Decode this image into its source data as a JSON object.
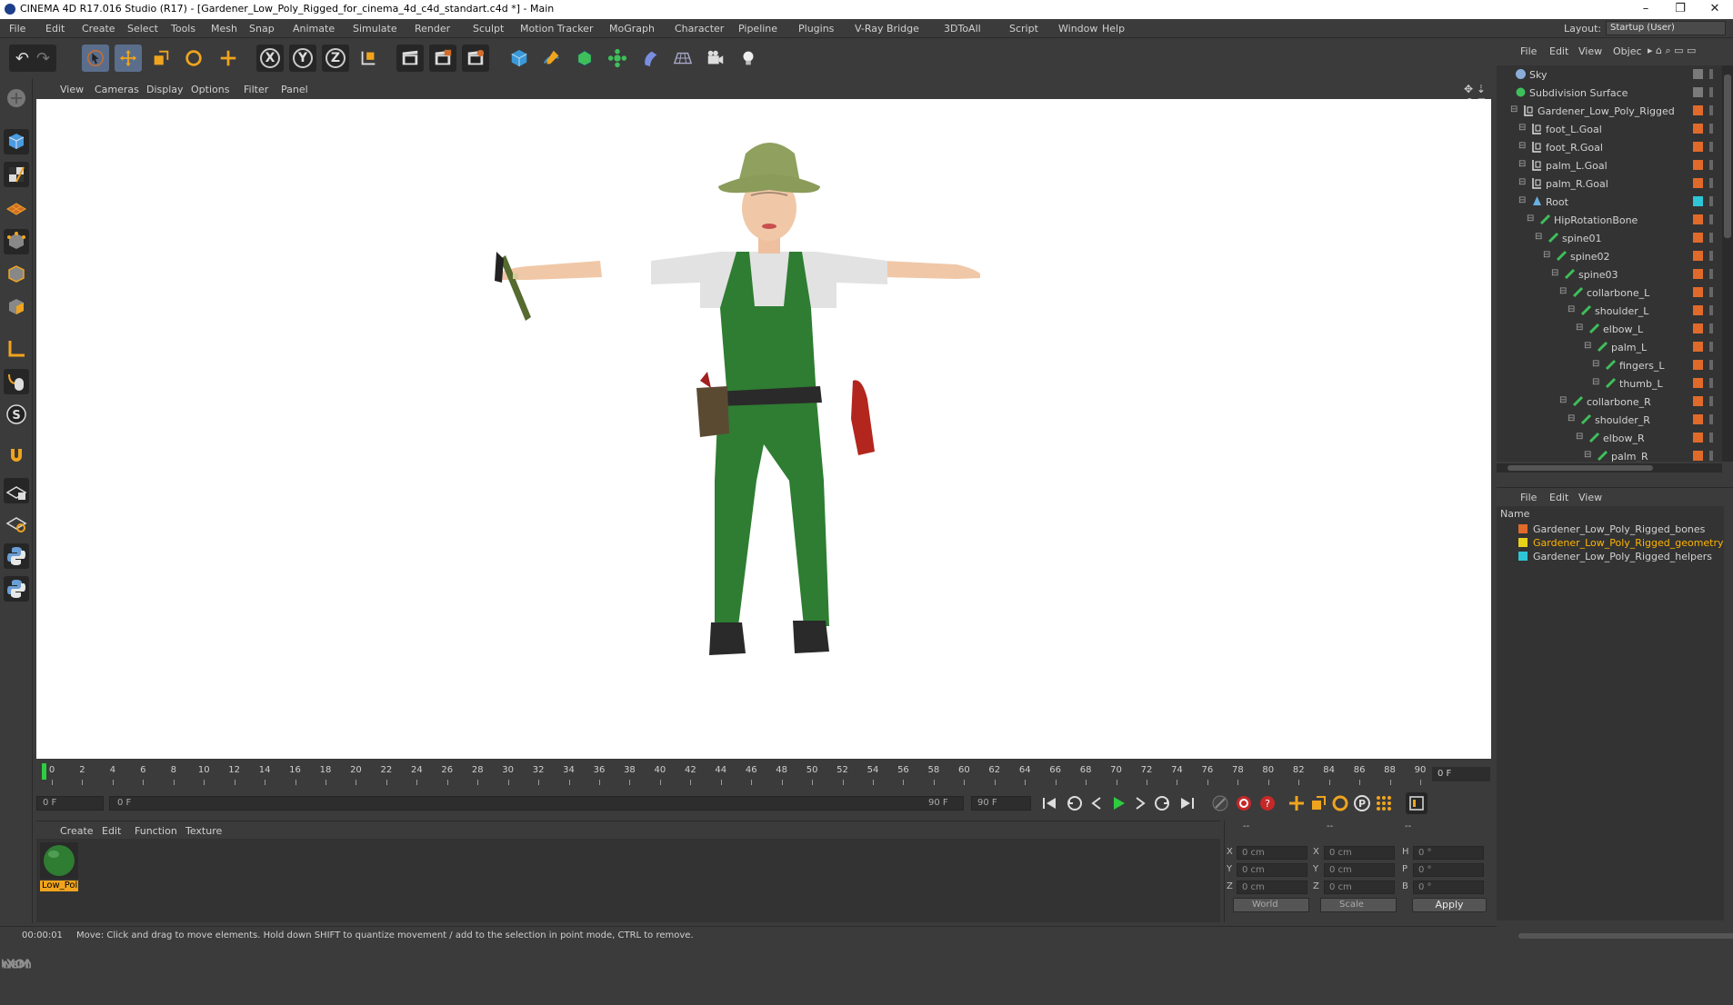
{
  "window": {
    "title": "CINEMA 4D R17.016 Studio (R17) - [Gardener_Low_Poly_Rigged_for_cinema_4d_c4d_standart.c4d *] - Main",
    "minimize": "–",
    "restore": "❐",
    "close": "✕"
  },
  "menubar": {
    "items": [
      "File",
      "Edit",
      "Create",
      "Select",
      "Tools",
      "Mesh",
      "Snap",
      "Animate",
      "Simulate",
      "Render",
      "Sculpt",
      "Motion Tracker",
      "MoGraph",
      "Character",
      "Pipeline",
      "Plugins",
      "V-Ray Bridge",
      "3DToAll",
      "Script",
      "Window",
      "Help"
    ],
    "layout_label": "Layout:",
    "layout_value": "Startup (User)"
  },
  "toolbar": {
    "x_label": "X",
    "y_label": "Y",
    "z_label": "Z"
  },
  "viewport": {
    "menu": [
      "View",
      "Cameras",
      "Display",
      "Options",
      "Filter",
      "Panel"
    ]
  },
  "timeline": {
    "ticks": [
      "0",
      "2",
      "4",
      "6",
      "8",
      "10",
      "12",
      "14",
      "16",
      "18",
      "20",
      "22",
      "24",
      "26",
      "28",
      "30",
      "32",
      "34",
      "36",
      "38",
      "40",
      "42",
      "44",
      "46",
      "48",
      "50",
      "52",
      "54",
      "56",
      "58",
      "60",
      "62",
      "64",
      "66",
      "68",
      "70",
      "72",
      "74",
      "76",
      "78",
      "80",
      "82",
      "84",
      "86",
      "88",
      "90"
    ],
    "current_frame": "0 F",
    "start_field": "0 F",
    "range_start": "0 F",
    "range_end": "90 F",
    "end_field": "90 F"
  },
  "materials": {
    "menu": [
      "Create",
      "Edit",
      "Function",
      "Texture"
    ],
    "items": [
      {
        "label": "Low_Pol"
      }
    ]
  },
  "coordinates": {
    "headers": [
      "--",
      "--",
      "--"
    ],
    "rows": [
      {
        "l1": "X",
        "v1": "0 cm",
        "l2": "X",
        "v2": "0 cm",
        "l3": "H",
        "v3": "0 °"
      },
      {
        "l1": "Y",
        "v1": "0 cm",
        "l2": "Y",
        "v2": "0 cm",
        "l3": "P",
        "v3": "0 °"
      },
      {
        "l1": "Z",
        "v1": "0 cm",
        "l2": "Z",
        "v2": "0 cm",
        "l3": "B",
        "v3": "0 °"
      }
    ],
    "mode1": "World",
    "mode2": "Scale",
    "apply_label": "Apply"
  },
  "status": {
    "time": "00:00:01",
    "message": "Move: Click and drag to move elements. Hold down SHIFT to quantize movement / add to the selection in point mode, CTRL to remove."
  },
  "object_manager": {
    "menu": [
      "File",
      "Edit",
      "View",
      "Objec"
    ],
    "objects": [
      {
        "name": "Sky",
        "indent": 0,
        "icon": "sky",
        "tag": "#7a7a7a"
      },
      {
        "name": "Subdivision Surface",
        "indent": 0,
        "icon": "subdiv",
        "tag": "#7a7a7a"
      },
      {
        "name": "Gardener_Low_Poly_Rigged",
        "indent": 1,
        "icon": "null",
        "tag": "#e06a2a"
      },
      {
        "name": "foot_L.Goal",
        "indent": 2,
        "icon": "null",
        "tag": "#e06a2a"
      },
      {
        "name": "foot_R.Goal",
        "indent": 2,
        "icon": "null",
        "tag": "#e06a2a"
      },
      {
        "name": "palm_L.Goal",
        "indent": 2,
        "icon": "null",
        "tag": "#e06a2a"
      },
      {
        "name": "palm_R.Goal",
        "indent": 2,
        "icon": "null",
        "tag": "#e06a2a"
      },
      {
        "name": "Root",
        "indent": 2,
        "icon": "root",
        "tag": "#2ec6d6"
      },
      {
        "name": "HipRotationBone",
        "indent": 3,
        "icon": "bone",
        "tag": "#e06a2a"
      },
      {
        "name": "spine01",
        "indent": 4,
        "icon": "bone",
        "tag": "#e06a2a"
      },
      {
        "name": "spine02",
        "indent": 5,
        "icon": "bone",
        "tag": "#e06a2a"
      },
      {
        "name": "spine03",
        "indent": 6,
        "icon": "bone",
        "tag": "#e06a2a"
      },
      {
        "name": "collarbone_L",
        "indent": 7,
        "icon": "bone",
        "tag": "#e06a2a"
      },
      {
        "name": "shoulder_L",
        "indent": 8,
        "icon": "bone",
        "tag": "#e06a2a"
      },
      {
        "name": "elbow_L",
        "indent": 9,
        "icon": "bone",
        "tag": "#e06a2a"
      },
      {
        "name": "palm_L",
        "indent": 10,
        "icon": "bone",
        "tag": "#e06a2a"
      },
      {
        "name": "fingers_L",
        "indent": 11,
        "icon": "bone",
        "tag": "#e06a2a"
      },
      {
        "name": "thumb_L",
        "indent": 11,
        "icon": "bone",
        "tag": "#e06a2a"
      },
      {
        "name": "collarbone_R",
        "indent": 7,
        "icon": "bone",
        "tag": "#e06a2a"
      },
      {
        "name": "shoulder_R",
        "indent": 8,
        "icon": "bone",
        "tag": "#e06a2a"
      },
      {
        "name": "elbow_R",
        "indent": 9,
        "icon": "bone",
        "tag": "#e06a2a"
      },
      {
        "name": "palm_R",
        "indent": 10,
        "icon": "bone",
        "tag": "#e06a2a"
      }
    ]
  },
  "layer_manager": {
    "menu": [
      "File",
      "Edit",
      "View"
    ],
    "header": "Name",
    "layers": [
      {
        "name": "Gardener_Low_Poly_Rigged_bones",
        "color": "#e06a2a",
        "selected": false
      },
      {
        "name": "Gardener_Low_Poly_Rigged_geometry",
        "color": "#e8d21a",
        "selected": true
      },
      {
        "name": "Gardener_Low_Poly_Rigged_helpers",
        "color": "#2ec6d6",
        "selected": false
      }
    ]
  }
}
